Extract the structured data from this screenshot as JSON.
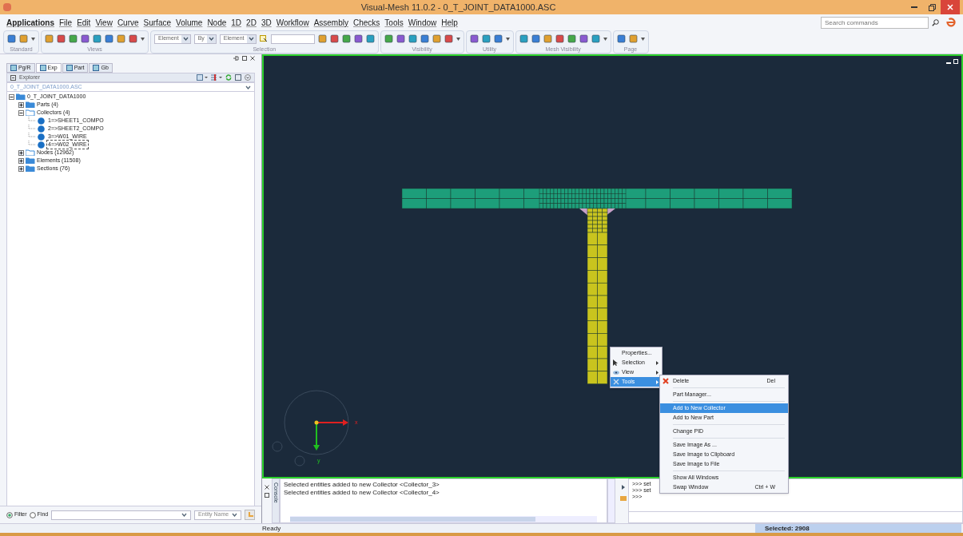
{
  "window": {
    "title": "Visual-Mesh 11.0.2 - 0_T_JOINT_DATA1000.ASC"
  },
  "menu_bar": [
    "Applications",
    "File",
    "Edit",
    "View",
    "Curve",
    "Surface",
    "Volume",
    "Node",
    "1D",
    "2D",
    "3D",
    "Workflow",
    "Assembly",
    "Checks",
    "Tools",
    "Window",
    "Help"
  ],
  "search": {
    "placeholder": "Search commands"
  },
  "toolbar_groups": [
    {
      "label": "Standard",
      "kind": "icons"
    },
    {
      "label": "Views",
      "kind": "icons"
    },
    {
      "label": "Selection",
      "kind": "selection",
      "dropdowns": [
        "Element",
        "By",
        "Element"
      ]
    },
    {
      "label": "Visibility",
      "kind": "icons"
    },
    {
      "label": "Utility",
      "kind": "icons"
    },
    {
      "label": "Mesh Visibility",
      "kind": "icons"
    },
    {
      "label": "Page",
      "kind": "icons"
    }
  ],
  "panel_tabs": [
    {
      "label": "Pg/R",
      "selected": false
    },
    {
      "label": "Exp",
      "selected": true
    },
    {
      "label": "Part",
      "selected": false
    },
    {
      "label": "Gb",
      "selected": false
    }
  ],
  "explorer": {
    "title": "Explorer",
    "file": "0_T_JOINT_DATA1000.ASC"
  },
  "tree": [
    {
      "label": "0_T_JOINT_DATA1000",
      "kind": "folder",
      "expanded": true,
      "children": [
        {
          "label": "Parts (4)",
          "kind": "folder",
          "expanded": false
        },
        {
          "label": "Collectors (4)",
          "kind": "open-folder",
          "expanded": true,
          "children": [
            {
              "label": "1=>SHEET1_COMPO",
              "kind": "collector",
              "selected": false
            },
            {
              "label": "2=>SHEET2_COMPO",
              "kind": "collector",
              "selected": false
            },
            {
              "label": "3=>W01_WIRE",
              "kind": "collector",
              "selected": false
            },
            {
              "label": "4=>W02_WIRE",
              "kind": "collector",
              "selected": true
            }
          ]
        },
        {
          "label": "Nodes (12962)",
          "kind": "open-folder",
          "expanded": false
        },
        {
          "label": "Elements (11508)",
          "kind": "folder",
          "expanded": false
        },
        {
          "label": "Sections (76)",
          "kind": "folder",
          "expanded": false
        }
      ]
    }
  ],
  "filter": {
    "options": [
      {
        "label": "Filter",
        "selected": true
      },
      {
        "label": "Find",
        "selected": false
      }
    ],
    "entity": "Entity Name"
  },
  "viewport": {
    "axis_x": "x",
    "axis_y": "y"
  },
  "context_menu": [
    {
      "label": "Properties...",
      "kind": "item",
      "selected": false
    },
    {
      "label": "Selection",
      "kind": "submenu",
      "selected": false
    },
    {
      "label": "View",
      "kind": "submenu",
      "selected": false
    },
    {
      "label": "Tools",
      "kind": "submenu",
      "selected": true
    }
  ],
  "submenu": [
    {
      "label": "Delete",
      "kind": "delete",
      "shortcut": "Del",
      "selected": false
    },
    {
      "kind": "separator"
    },
    {
      "label": "Part Manager...",
      "kind": "item",
      "selected": false
    },
    {
      "kind": "separator"
    },
    {
      "label": "Add to New Collector",
      "kind": "item",
      "selected": true
    },
    {
      "label": "Add to New Part",
      "kind": "item",
      "selected": false
    },
    {
      "kind": "separator"
    },
    {
      "label": "Change PID",
      "kind": "item",
      "selected": false
    },
    {
      "kind": "separator"
    },
    {
      "label": "Save Image As ...",
      "kind": "item",
      "selected": false
    },
    {
      "label": "Save Image to Clipboard",
      "kind": "item",
      "selected": false
    },
    {
      "label": "Save Image to File",
      "kind": "item",
      "selected": false
    },
    {
      "kind": "separator"
    },
    {
      "label": "Show All Windows",
      "kind": "item",
      "selected": false
    },
    {
      "label": "Swap Window",
      "kind": "item",
      "shortcut": "Ctrl + W",
      "selected": false
    }
  ],
  "console": {
    "tab": "Console",
    "lines": [
      "Selected entities added to new Collector <Collector_3>",
      "Selected entities added to new Collector <Collector_4>"
    ]
  },
  "script": {
    "lines": [
      ">>> set",
      ">>> set",
      ">>>"
    ]
  },
  "status_bar": {
    "left": "Ready",
    "right": "Selected: 2908"
  }
}
